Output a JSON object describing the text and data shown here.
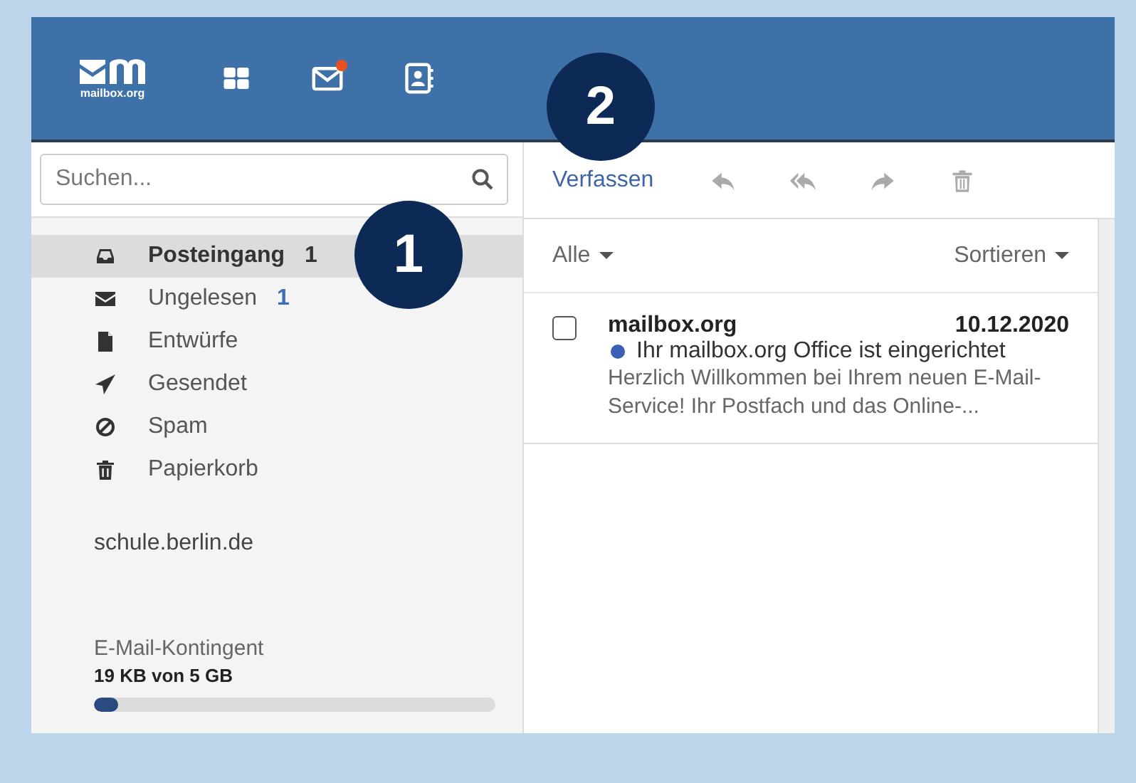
{
  "header": {
    "logo_text": "mailbox.org",
    "apps": [
      {
        "kind": "grid"
      },
      {
        "kind": "mail",
        "badge": true
      },
      {
        "kind": "contacts"
      }
    ]
  },
  "search": {
    "placeholder": "Suchen..."
  },
  "folders": [
    {
      "kind": "inbox",
      "label": "Posteingang",
      "count": "1",
      "selected": true
    },
    {
      "kind": "unread",
      "label": "Ungelesen",
      "count": "1",
      "selected": false
    },
    {
      "kind": "drafts",
      "label": "Entwürfe",
      "selected": false
    },
    {
      "kind": "sent",
      "label": "Gesendet",
      "selected": false
    },
    {
      "kind": "spam",
      "label": "Spam",
      "selected": false
    },
    {
      "kind": "trash",
      "label": "Papierkorb",
      "selected": false
    }
  ],
  "account": "schule.berlin.de",
  "quota": {
    "label": "E-Mail-Kontingent",
    "usage": "19 KB von 5 GB",
    "level": 0.06
  },
  "toolbar": {
    "compose": "Verfassen",
    "actions": [
      {
        "kind": "reply",
        "disabled": true
      },
      {
        "kind": "reply-all",
        "disabled": true
      },
      {
        "kind": "forward",
        "disabled": true
      },
      {
        "kind": "delete",
        "disabled": true
      }
    ]
  },
  "list_header": {
    "filter": "Alle",
    "sort": "Sortieren"
  },
  "messages": [
    {
      "sender": "mailbox.org",
      "date": "10.12.2020",
      "subject": "Ihr mailbox.org Office ist eingerichtet",
      "preview": "Herzlich Willkommen bei Ihrem neuen E-Mail-Service! Ihr Postfach und das Online-...",
      "checked": false,
      "unread": true
    }
  ],
  "callouts": [
    {
      "number": "1"
    },
    {
      "number": "2"
    }
  ]
}
